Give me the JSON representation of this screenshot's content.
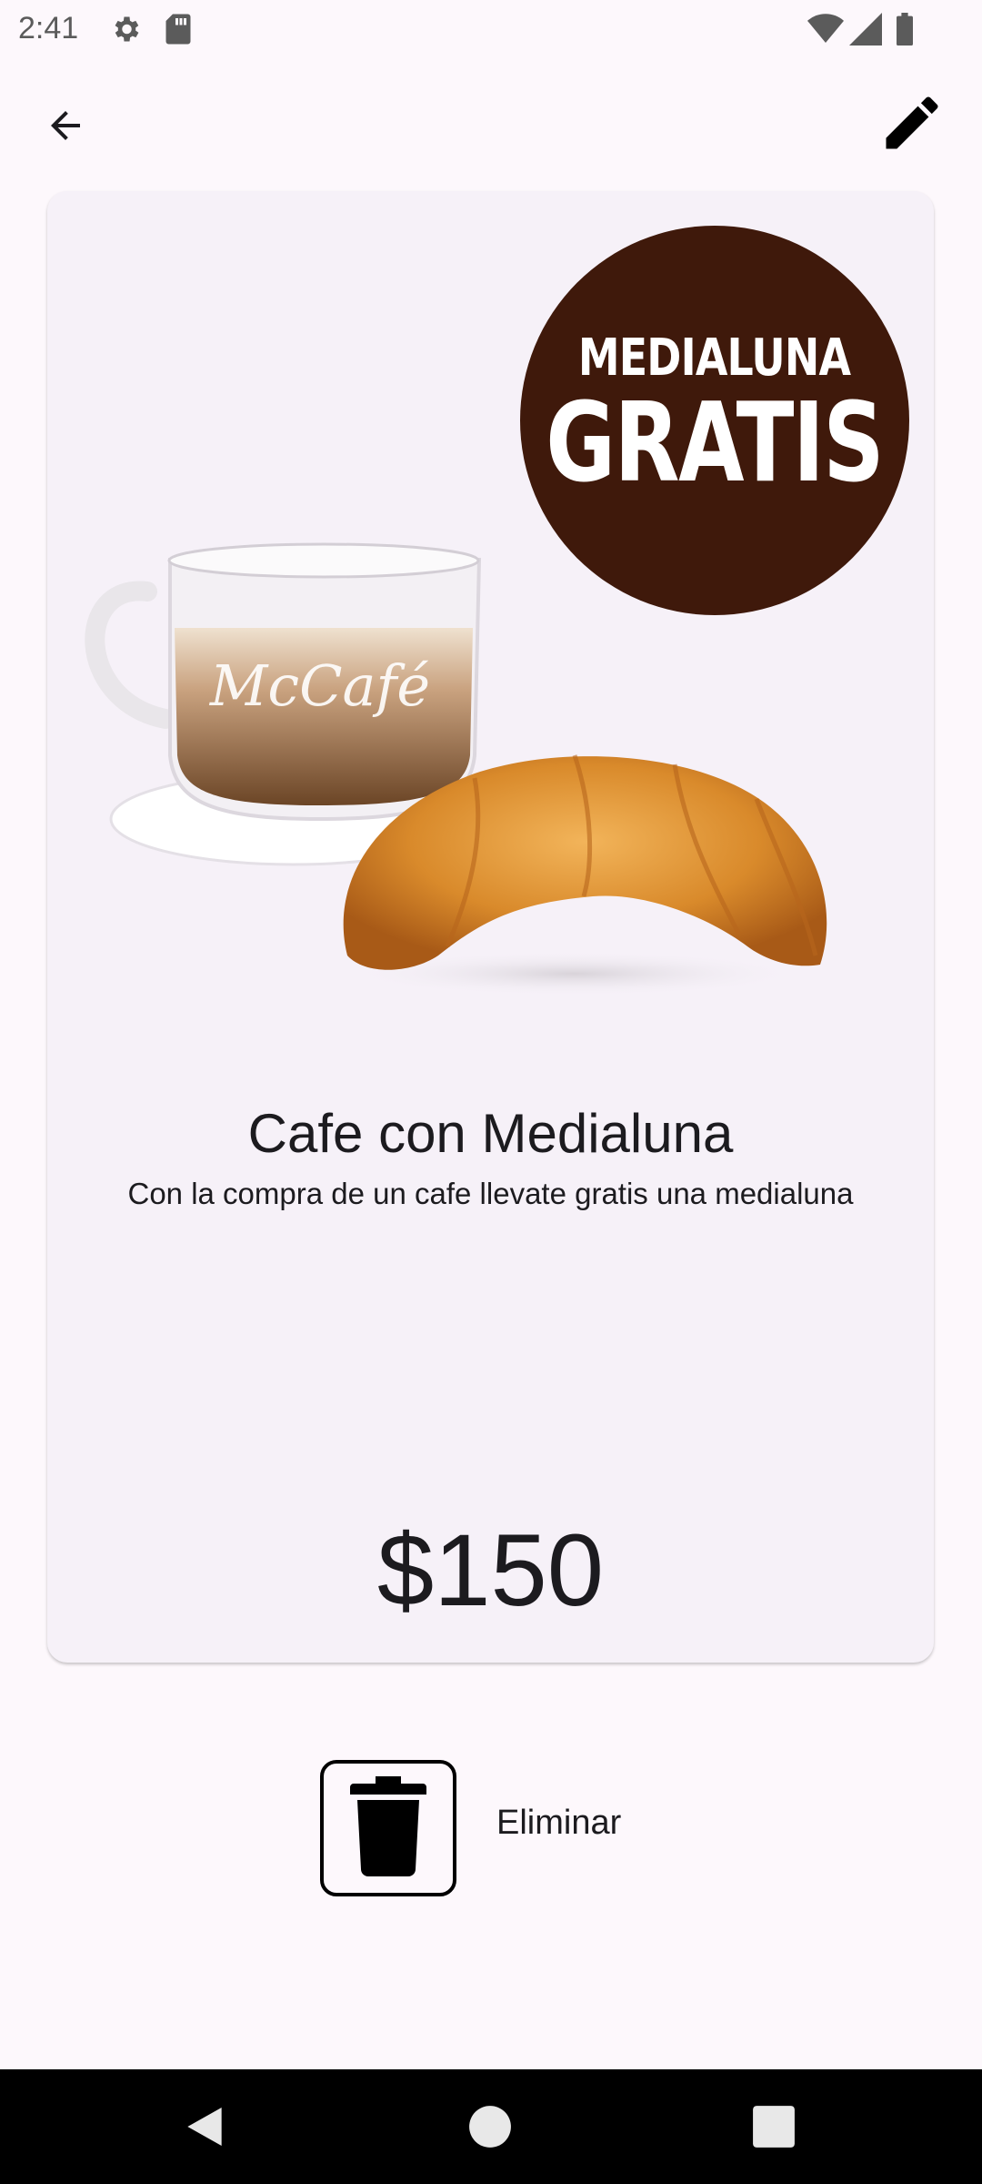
{
  "status_bar": {
    "time": "2:41",
    "icons": [
      "settings-icon",
      "sd-card-icon",
      "wifi-icon",
      "signal-icon",
      "battery-icon"
    ]
  },
  "app_bar": {
    "back_icon": "arrow-back-icon",
    "edit_icon": "pencil-edit-icon"
  },
  "card": {
    "image": {
      "promo_line1": "MEDIALUNA",
      "promo_line2": "GRATIS",
      "cup_brand": "McCafé"
    },
    "title": "Cafe con Medialuna",
    "description": "Con la compra de un cafe llevate gratis una medialuna",
    "price": "$150"
  },
  "actions": {
    "delete_icon": "trash-icon",
    "delete_label": "Eliminar"
  },
  "nav_bar": {
    "icons": [
      "nav-back-icon",
      "nav-home-icon",
      "nav-recents-icon"
    ]
  },
  "colors": {
    "background": "#fdf8fc",
    "card": "#f6f1f8",
    "promo_badge": "#3f190b",
    "text": "#1c1b1f"
  }
}
